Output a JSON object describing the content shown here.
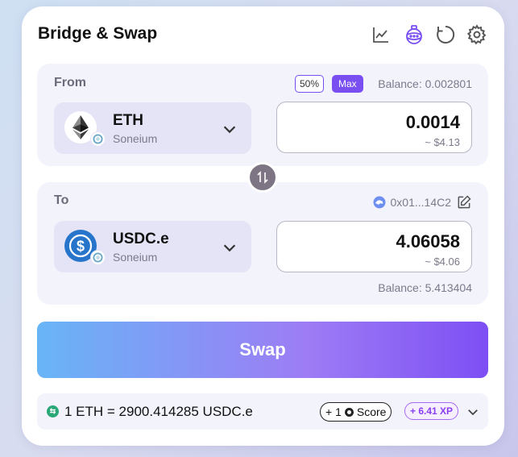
{
  "header": {
    "title": "Bridge & Swap",
    "icons": [
      "chart-icon",
      "ornament-icon",
      "refresh-icon",
      "gear-icon"
    ]
  },
  "from": {
    "label": "From",
    "percent_label": "50%",
    "max_label": "Max",
    "balance": "Balance: 0.002801",
    "token_symbol": "ETH",
    "token_chain": "Soneium",
    "amount": "0.0014",
    "amount_usd": "~ $4.13"
  },
  "to": {
    "label": "To",
    "address": "0x01...14C2",
    "token_symbol": "USDC.e",
    "token_chain": "Soneium",
    "amount": "4.06058",
    "amount_usd": "~ $4.06",
    "balance": "Balance: 5.413404"
  },
  "swap_button": {
    "label": "Swap"
  },
  "rate": {
    "text": "1 ETH = 2900.414285 USDC.e",
    "score_prefix": "+ 1",
    "score_label": "Score",
    "xp": "+ 6.41 XP"
  },
  "colors": {
    "accent": "#7a4ff2",
    "panel": "#f3f3fc",
    "usdc_blue": "#2775ca"
  }
}
